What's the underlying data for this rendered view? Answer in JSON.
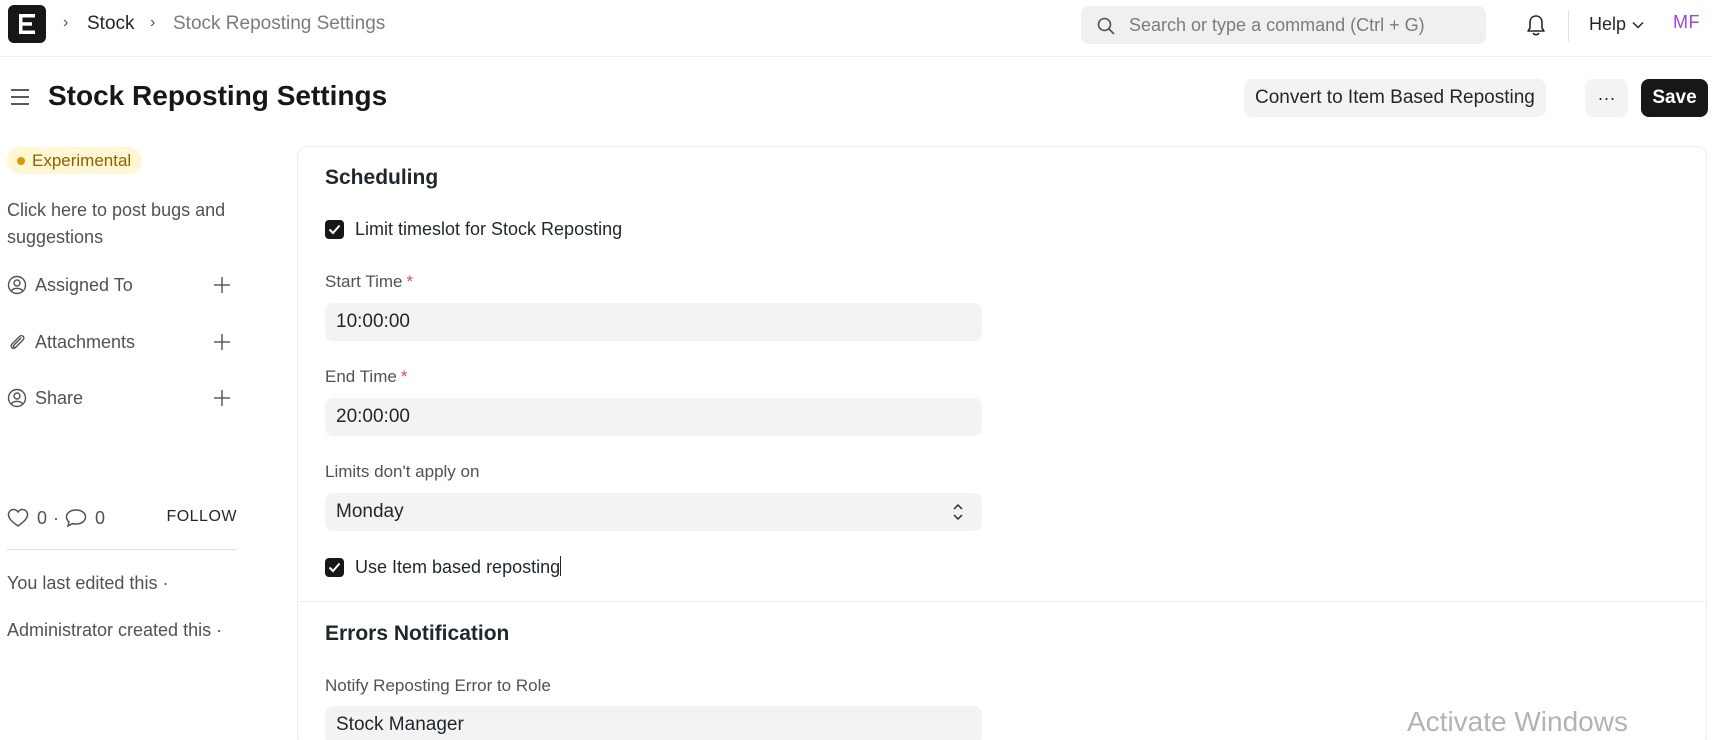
{
  "navbar": {
    "logo_letter": "E",
    "breadcrumbs": [
      "Stock",
      "Stock Reposting Settings"
    ],
    "search_placeholder": "Search or type a command (Ctrl + G)",
    "help_label": "Help",
    "avatar_initials": "MF"
  },
  "header": {
    "title": "Stock Reposting Settings",
    "convert_label": "Convert to Item Based Reposting",
    "more_label": "···",
    "save_label": "Save"
  },
  "sidebar": {
    "badge": "Experimental",
    "bug_link": "Click here to post bugs and suggestions",
    "items": [
      {
        "label": "Assigned To",
        "icon": "user-add-icon"
      },
      {
        "label": "Attachments",
        "icon": "paperclip-icon"
      },
      {
        "label": "Share",
        "icon": "share-user-icon"
      }
    ],
    "likes": "0",
    "separator": "·",
    "comments": "0",
    "follow_label": "FOLLOW",
    "last_edited": "You last edited this ·",
    "created": "Administrator created this ·"
  },
  "form": {
    "scheduling": {
      "title": "Scheduling",
      "limit_timeslot_label": "Limit timeslot for Stock Reposting",
      "limit_timeslot_checked": true,
      "start_time_label": "Start Time",
      "start_time_value": "10:00:00",
      "end_time_label": "End Time",
      "end_time_value": "20:00:00",
      "required_mark": "*",
      "limits_label": "Limits don't apply on",
      "limits_value": "Monday",
      "item_based_label": "Use Item based reposting",
      "item_based_checked": true
    },
    "errors": {
      "title": "Errors Notification",
      "notify_label": "Notify Reposting Error to Role",
      "notify_value": "Stock Manager"
    }
  },
  "watermark": "Activate Windows",
  "colors": {
    "primary": "#171717",
    "badge_bg": "#fff7d3",
    "badge_text": "#8f6100",
    "required": "#e24c4c",
    "avatar": "#9c45e3"
  }
}
